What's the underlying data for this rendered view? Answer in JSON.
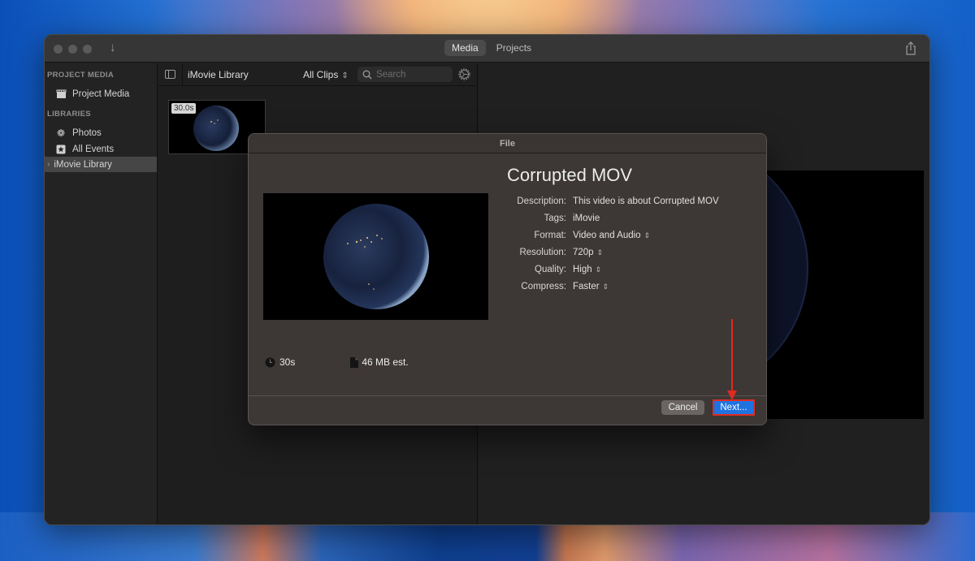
{
  "window": {
    "tabs": [
      {
        "label": "Media",
        "active": true
      },
      {
        "label": "Projects",
        "active": false
      }
    ]
  },
  "sidebar": {
    "section_project_media": "PROJECT MEDIA",
    "project_media_item": "Project Media",
    "section_libraries": "LIBRARIES",
    "items": [
      {
        "label": "Photos",
        "icon": "photos-flower-icon"
      },
      {
        "label": "All Events",
        "icon": "star-icon"
      },
      {
        "label": "iMovie Library",
        "icon": "chevron-right-icon",
        "selected": true
      }
    ]
  },
  "browser": {
    "library_title": "iMovie Library",
    "filter_label": "All Clips",
    "search_placeholder": "Search",
    "clip_duration": "30.0s"
  },
  "dialog": {
    "title": "File",
    "video_title": "Corrupted MOV",
    "properties": [
      {
        "label": "Description:",
        "value": "This video is about Corrupted MOV",
        "popup": false
      },
      {
        "label": "Tags:",
        "value": "iMovie",
        "popup": false
      },
      {
        "label": "Format:",
        "value": "Video and Audio",
        "popup": true
      },
      {
        "label": "Resolution:",
        "value": "720p",
        "popup": true
      },
      {
        "label": "Quality:",
        "value": "High",
        "popup": true
      },
      {
        "label": "Compress:",
        "value": "Faster",
        "popup": true
      }
    ],
    "duration": "30s",
    "size_estimate": "46 MB est.",
    "cancel_label": "Cancel",
    "next_label": "Next...",
    "accent_color": "#1f73e0",
    "highlight_color": "#e02b20"
  }
}
